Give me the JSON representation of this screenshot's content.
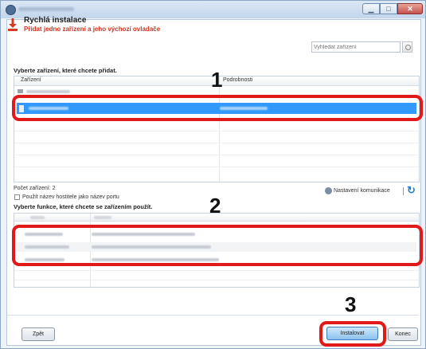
{
  "window": {
    "title_hidden": true
  },
  "header": {
    "title": "Rychlá instalace",
    "subtitle": "Přidat jedno zařízení a jeho výchozí ovladače"
  },
  "device_section": {
    "label": "Vyberte zařízení, které chcete přidat.",
    "search_placeholder": "Vyhledat zařízení",
    "columns": [
      "Zařízení",
      "Podrobnosti"
    ],
    "count_text": "Počet zařízení: 2",
    "hostname_checkbox_label": "Použít název hostitele jako název portu",
    "comm_settings_label": "Nastavení komunikace"
  },
  "function_section": {
    "label": "Vyberte funkce, které chcete se zařízením použít."
  },
  "buttons": {
    "back": "Zpět",
    "install": "Instalovat",
    "end": "Konec"
  },
  "callouts": [
    "1",
    "2",
    "3"
  ],
  "colors": {
    "highlight": "#e11919",
    "selection": "#3399ff",
    "subtitle": "#d2331f"
  }
}
